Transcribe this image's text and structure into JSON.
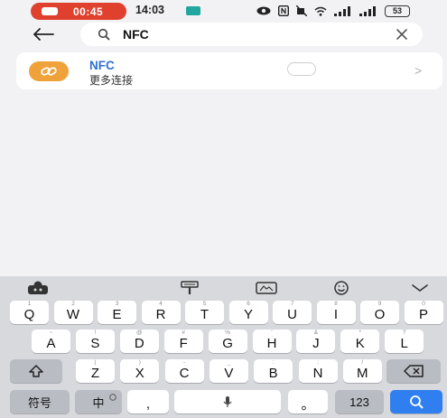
{
  "status_bar": {
    "recording_time": "00:45",
    "clock": "14:03",
    "battery_level": "53"
  },
  "search": {
    "query": "NFC"
  },
  "result": {
    "title": "NFC",
    "subtitle": "更多连接",
    "toggle_on": false
  },
  "keyboard": {
    "row1": [
      {
        "letter": "Q",
        "hint": "1"
      },
      {
        "letter": "W",
        "hint": "2"
      },
      {
        "letter": "E",
        "hint": "3"
      },
      {
        "letter": "R",
        "hint": "4"
      },
      {
        "letter": "T",
        "hint": "5"
      },
      {
        "letter": "Y",
        "hint": "6"
      },
      {
        "letter": "U",
        "hint": "7"
      },
      {
        "letter": "I",
        "hint": "8"
      },
      {
        "letter": "O",
        "hint": "9"
      },
      {
        "letter": "P",
        "hint": "0"
      }
    ],
    "row2": [
      {
        "letter": "A",
        "hint": "~"
      },
      {
        "letter": "S",
        "hint": "!"
      },
      {
        "letter": "D",
        "hint": "@"
      },
      {
        "letter": "F",
        "hint": "#"
      },
      {
        "letter": "G",
        "hint": "%"
      },
      {
        "letter": "H",
        "hint": "'"
      },
      {
        "letter": "J",
        "hint": "&"
      },
      {
        "letter": "K",
        "hint": "*"
      },
      {
        "letter": "L",
        "hint": "?"
      }
    ],
    "row3": [
      {
        "letter": "Z",
        "hint": "("
      },
      {
        "letter": "X",
        "hint": ")"
      },
      {
        "letter": "C",
        "hint": "-"
      },
      {
        "letter": "V",
        "hint": "_"
      },
      {
        "letter": "B",
        "hint": ":"
      },
      {
        "letter": "N",
        "hint": ";"
      },
      {
        "letter": "M",
        "hint": "/"
      }
    ],
    "symbols_label": "符号",
    "language_label": "中",
    "comma_label": ",",
    "period_label": "。",
    "numbers_label": "123"
  },
  "colors": {
    "accent_blue": "#2f7ff0",
    "record_red": "#e0412f",
    "nfc_orange": "#f0a23a",
    "title_blue": "#2f6fd1"
  }
}
